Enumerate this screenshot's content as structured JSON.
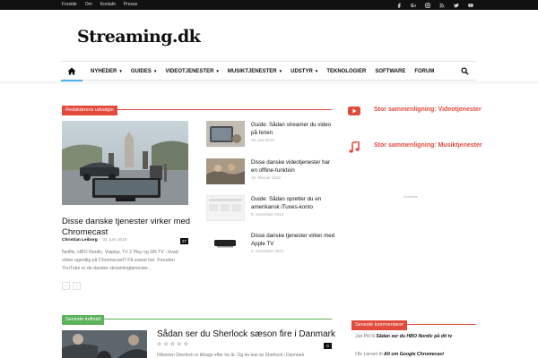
{
  "topbar": {
    "links": [
      "Forside",
      "Om",
      "Kontakt",
      "Presse"
    ],
    "social_icons": [
      "facebook-icon",
      "google-plus-icon",
      "instagram-icon",
      "rss-icon",
      "twitter-icon",
      "youtube-icon"
    ]
  },
  "logo": "Streaming.dk",
  "nav": {
    "home_icon": "home-icon",
    "items": [
      {
        "label": "NYHEDER",
        "dropdown": true
      },
      {
        "label": "GUIDES",
        "dropdown": true
      },
      {
        "label": "VIDEOTJENESTER",
        "dropdown": true
      },
      {
        "label": "MUSIKTJENESTER",
        "dropdown": true
      },
      {
        "label": "UDSTYR",
        "dropdown": true
      },
      {
        "label": "TEKNOLOGIER",
        "dropdown": false
      },
      {
        "label": "SOFTWARE",
        "dropdown": false
      },
      {
        "label": "FORUM",
        "dropdown": false
      }
    ],
    "search_icon": "search-icon"
  },
  "editors_pick": {
    "header": "Redaktørens udvalgte",
    "featured": {
      "title": "Disse danske tjenester virker med Chromecast",
      "author": "Christian Leiborg",
      "date": "30. juni 2015",
      "comments": "27",
      "excerpt": "Netflix, HBO Nordic, Viaplay, TV 2 Play og DR TV - hvad virker egentlig på Chromecast? Få svaret her. Foruden YouTube er de danske streamingtjenester..."
    },
    "list": [
      {
        "title": "Guide: Sådan streamer du video på ferien",
        "date": "16. juni 2015"
      },
      {
        "title": "Disse danske videotjenester har en offline-funktion",
        "date": "19. februar 2015"
      },
      {
        "title": "Guide: Sådan opretter du en amerikansk iTunes-konto",
        "date": "9. november 2014"
      },
      {
        "title": "Disse danske tjenester virker med Apple TV",
        "date": "4. november 2014"
      }
    ],
    "pager": [
      "‹",
      "›"
    ]
  },
  "sidebar": {
    "items": [
      {
        "label": "Stor sammenligning: Videotjenester",
        "icon": "youtube-play-icon"
      },
      {
        "label": "Stor sammenligning: Musiktjenester",
        "icon": "music-note-icon"
      }
    ],
    "ad_label": "Annonce",
    "comments_header": "Seneste kommentarer",
    "comments": [
      {
        "author": "Jan Pill",
        "connector": "til",
        "post": "Sådan ser du HBO Nordic på dit tv"
      },
      {
        "author": "Ole Larsen",
        "connector": "til",
        "post": "Alt om Google Chromecast"
      }
    ]
  },
  "latest": {
    "header": "Seneste indhold",
    "featured": {
      "title": "Sådan ser du Sherlock sæson fire i Danmark",
      "comments": "0",
      "rating_stars": 5,
      "rating_value": 0,
      "excerpt": "Hitserien Sherlock er tilbage efter tre år. Og du kan se Sherlock i Danmark"
    }
  },
  "colors": {
    "accent": "#e24a3c",
    "green": "#5cb35c",
    "topbar": "#111111",
    "home_underline": "#4db2ec"
  }
}
